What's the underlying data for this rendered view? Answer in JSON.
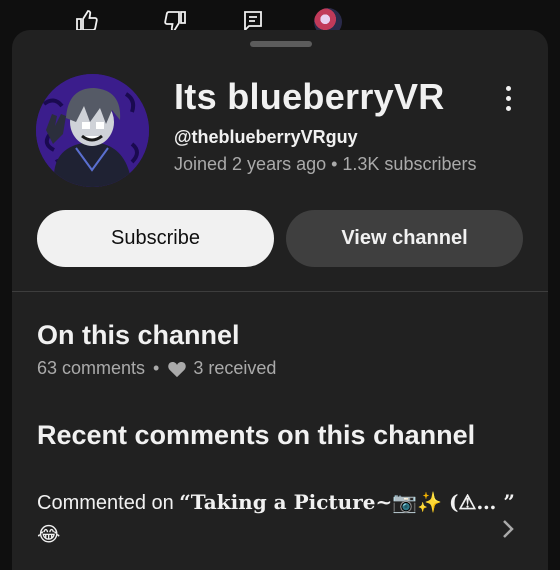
{
  "top_bar": {
    "icons": [
      "thumbs-up-icon",
      "thumbs-down-icon",
      "comment-icon",
      "profile-avatar"
    ]
  },
  "channel": {
    "name": "Its blueberryVR",
    "handle": "@theblueberryVRguy",
    "meta": "Joined 2 years ago • 1.3K subscribers",
    "avatar_colors": {
      "background": "#3b1d8c",
      "hair": "#555a66",
      "hoodie": "#1f2233"
    }
  },
  "buttons": {
    "subscribe": "Subscribe",
    "view_channel": "View channel"
  },
  "on_this_channel": {
    "title": "On this channel",
    "comments": "63 comments",
    "separator": "•",
    "received": "3 received"
  },
  "recent": {
    "title": "Recent comments on this channel",
    "commented_prefix": "Commented on ",
    "video_title": "“Taking a Picture~📷✨ (⚠… ”",
    "emoji": "😂"
  },
  "colors": {
    "page_bg": "#0f0f0f",
    "sheet_bg": "#212121",
    "primary_text": "#f1f1f1",
    "secondary_text": "#aaaaaa",
    "subscribe_bg": "#f1f1f1",
    "view_channel_bg": "#3f3f3f"
  }
}
